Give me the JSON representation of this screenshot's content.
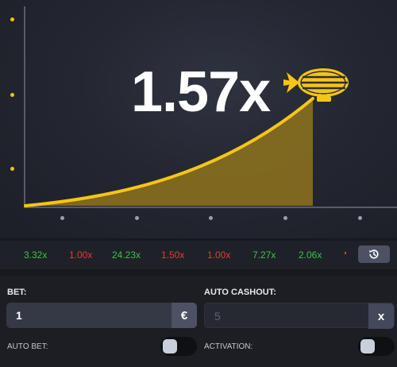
{
  "game": {
    "multiplier": "1.57x",
    "curve_color": "#f5c518",
    "fill_color": "#8a6f1d",
    "icon": "blimp-icon"
  },
  "history": {
    "items": [
      {
        "value": "3.32x",
        "status": "green"
      },
      {
        "value": "1.00x",
        "status": "red"
      },
      {
        "value": "24.23x",
        "status": "green"
      },
      {
        "value": "1.50x",
        "status": "red"
      },
      {
        "value": "1.00x",
        "status": "red"
      },
      {
        "value": "7.27x",
        "status": "green"
      },
      {
        "value": "2.06x",
        "status": "green"
      }
    ],
    "button_icon": "history-clock-icon"
  },
  "controls": {
    "bet": {
      "label": "BET:",
      "value": "1",
      "currency_symbol": "€"
    },
    "auto_cashout": {
      "label": "AUTO CASHOUT:",
      "placeholder": "5",
      "suffix": "x"
    },
    "auto_bet": {
      "label": "AUTO BET:",
      "enabled": false
    },
    "activation": {
      "label": "ACTIVATION:",
      "enabled": false
    }
  },
  "colors": {
    "win": "#3cc24a",
    "loss": "#e6383a",
    "accent": "#f1c40f"
  }
}
